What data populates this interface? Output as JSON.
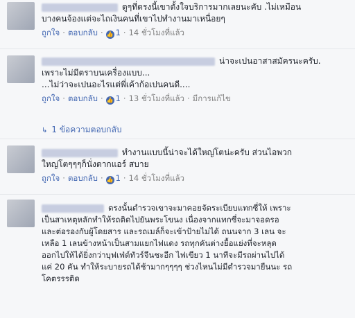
{
  "comments": [
    {
      "text": "ดูๆที่ตรงนี้เขาตั้งใจบริการมากเลยนะคับ .ไม่เหมือน\nบางคนจ้องแต่จะไถเงินคนที่เขาไปทำงานมาเหนื่อยๆ",
      "like_label": "ถูกใจ",
      "reply_label": "ตอบกลับ",
      "like_count": "1",
      "time": "14 ชั่วโมงที่แล้ว",
      "edited": ""
    },
    {
      "text": "น่าจะเปนอาสาสมัครนะครับ.\nเพราะไม่มีตราบนเครื่องแบบ...\n...ไม่ว่าจะเปนอะไรแต่พี่เค้าก้อเปนคนดี....",
      "like_label": "ถูกใจ",
      "reply_label": "ตอบกลับ",
      "like_count": "1",
      "time": "13 ชั่วโมงที่แล้ว",
      "edited": "มีการแก้ไข"
    },
    {
      "text": "ทำงานแบบนี้น่าจะได้ใหญ่โตน่ะครับ ส่วนไอพวก\nใหญ่โตๆๆๆก็นั่งตากแอร์ สบาย",
      "like_label": "ถูกใจ",
      "reply_label": "ตอบกลับ",
      "like_count": "1",
      "time": "14 ชั่วโมงที่แล้ว",
      "edited": ""
    },
    {
      "text": "ตรงนั้นตำรวจเขาจะมาคอยจัดระเบียบแทกซี่ให้ เพราะ\nเป็นสาเหตุหลักทำให้รถติดไปยันพระโขนง เนื่องจากแทกซี่จะมาจอดรอ\nและต่อรองกับผู้โดยสาร และรถเมล์ก็จะเข้าป้ายไม่ได้ ถนนจาก 3 เลน จะ\nเหลือ 1 เลนข้างหน้าเป็นสามแยกไฟแดง รถทุกคันต่างยื้อแย่งที่จะหลุด\nออกไปให้ได้ยิ่งกว่าบุฟเฟ่ต์ทัวร์จีนชะอีก ไฟเขียว 1 นาทีจะมีรถผ่านไปได้\nแค่ 20 คัน ทำให้ระบายรถได้ช้ามากๆๆๆๆ ช่วงไหนไม่มีตำรวจมายืนนะ รถ\nโคตรรรติด",
      "like_label": "",
      "reply_label": "",
      "like_count": "",
      "time": "",
      "edited": ""
    }
  ],
  "replies_link": "1 ข้อความตอบกลับ",
  "icons": {
    "like": "like-icon",
    "reply_arrow": "reply-arrow-icon"
  },
  "colors": {
    "link": "#4267b2",
    "meta": "#7f7f7f",
    "background": "#f6f7f9"
  }
}
